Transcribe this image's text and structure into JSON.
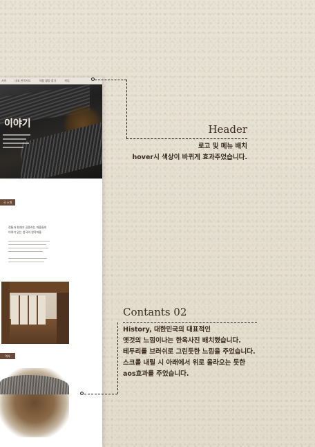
{
  "mockup": {
    "nav": [
      "사이",
      "대표 한옥지도",
      "체험 활동 참가",
      "게임"
    ],
    "hero_title": "이야기",
    "section1_tag": "국 소개",
    "section1_heading": [
      "전통과 현재가 공존하는 마을들의",
      "이야기 있는 한국의 한옥마을"
    ],
    "section2_tag": "역사"
  },
  "header_label": {
    "title": "Header",
    "lines": [
      "로고 및 메뉴 배치",
      "hover시 색상이 바뀌게 효과주었습니다."
    ]
  },
  "contents_label": {
    "title": "Contants 02",
    "lines": [
      "History, 대한민국의 대표적인",
      "옛것의 느낌이나는 한옥사진 배치했습니다.",
      "테두리를 브러쉬로 그린듯한 느낌을 주었습니다.",
      "스크롤 내릴 시 아래에서 위로 올라오는 듯한",
      "aos효과를 주었습니다."
    ]
  }
}
